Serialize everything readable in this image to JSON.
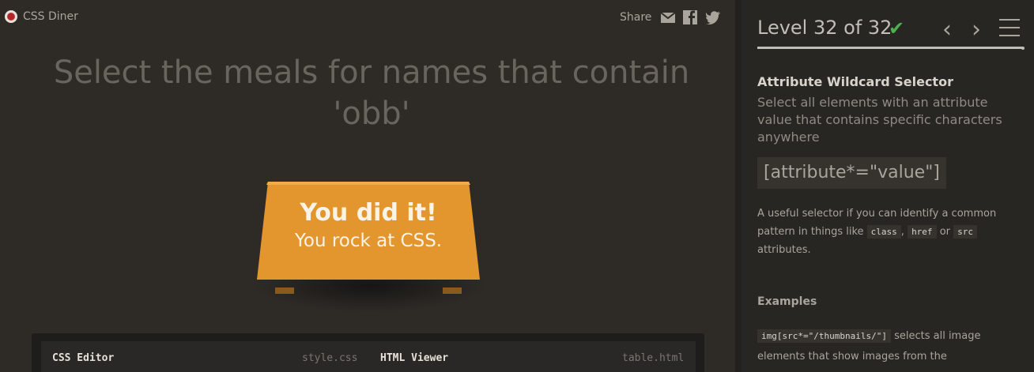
{
  "app": {
    "brand": "CSS Diner",
    "share_label": "Share",
    "share_icons": [
      "envelope-icon",
      "facebook-icon",
      "twitter-icon"
    ],
    "colors": {
      "background": "#2e2b27",
      "table": "#e4962e",
      "success": "#4caf50"
    }
  },
  "game": {
    "instruction": "Select the meals for names that contain 'obb'",
    "win_title": "You did it!",
    "win_sub": "You rock at CSS."
  },
  "editor": {
    "css_label": "CSS Editor",
    "css_file": "style.css",
    "html_label": "HTML Viewer",
    "html_file": "table.html"
  },
  "sidebar": {
    "level_text": "Level 32 of 32",
    "completed": true,
    "progress": 1.0,
    "selector_name": "Attribute Wildcard Selector",
    "selector_desc": "Select all elements with an attribute value that contains specific characters anywhere",
    "syntax": "[attribute*=\"value\"]",
    "hint_before": "A useful selector if you can identify a common pattern in things like",
    "hint_code_1": "class",
    "hint_comma": ",",
    "hint_code_2": "href",
    "hint_or": "or",
    "hint_code_3": "src",
    "hint_after": "attributes.",
    "examples_heading": "Examples",
    "example_code": "img[src*=\"/thumbnails/\"]",
    "example_text": "selects all image elements that show images from the"
  }
}
